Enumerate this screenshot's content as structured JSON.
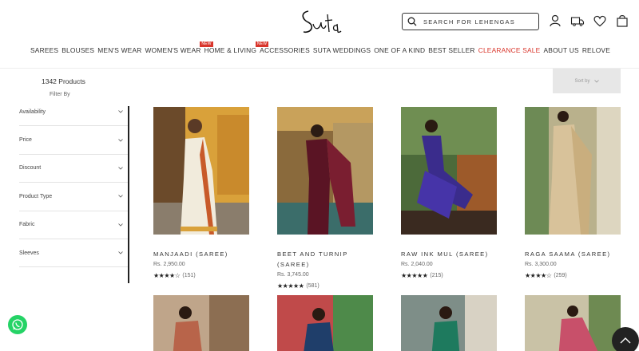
{
  "header": {
    "logo_text": "Suta",
    "search_placeholder": "SEARCH FOR LEHENGAS",
    "icons": [
      "account-icon",
      "truck-icon",
      "heart-icon",
      "bag-icon"
    ]
  },
  "nav": {
    "items": [
      {
        "label": "SAREES"
      },
      {
        "label": "BLOUSES"
      },
      {
        "label": "MEN'S WEAR"
      },
      {
        "label": "WOMEN'S WEAR",
        "badge": "NEW"
      },
      {
        "label": "HOME & LIVING",
        "badge": "NEW"
      },
      {
        "label": "ACCESSORIES"
      },
      {
        "label": "SUTA WEDDINGS"
      },
      {
        "label": "ONE OF A KIND"
      },
      {
        "label": "BEST SELLER"
      },
      {
        "label": "CLEARANCE SALE",
        "highlight": "#d9352b"
      },
      {
        "label": "ABOUT US"
      },
      {
        "label": "RELOVE"
      }
    ]
  },
  "listing": {
    "count_text": "1342 Products",
    "filter_by": "Filter By",
    "sort_by": "Sort by"
  },
  "filters": [
    "Availability",
    "Price",
    "Discount",
    "Product Type",
    "Fabric",
    "Sleeves"
  ],
  "products": [
    {
      "name": "MANJAADI (SAREE)",
      "price": "Rs. 2,950.00",
      "rating": 4.5,
      "reviews": "(151)"
    },
    {
      "name": "BEET AND TURNIP (SAREE)",
      "price": "Rs. 3,745.00",
      "rating": 5,
      "reviews": "(581)"
    },
    {
      "name": "RAW INK MUL (SAREE)",
      "price": "Rs. 2,040.00",
      "rating": 5,
      "reviews": "(215)"
    },
    {
      "name": "RAGA SAAMA (SAREE)",
      "price": "Rs. 3,300.00",
      "rating": 4.5,
      "reviews": "(259)"
    }
  ],
  "colors": {
    "accent": "#d9352b",
    "whatsapp": "#25d366",
    "text": "#333333"
  }
}
